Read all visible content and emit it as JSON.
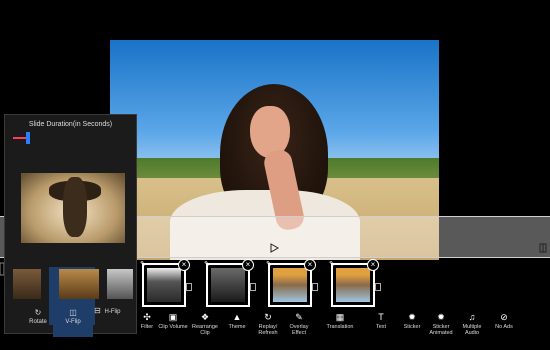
{
  "panel": {
    "title": "Slide Duration(in Seconds)",
    "actions": [
      {
        "label": "Rotate",
        "icon": "rotate-icon"
      },
      {
        "label": "V-Flip",
        "icon": "v-flip-icon"
      },
      {
        "label": "H-Flip",
        "icon": "h-flip-icon"
      }
    ],
    "slider_value_fraction": 0.1,
    "colors": {
      "accent": "#2b7fff",
      "track": "#ff3a5a",
      "selected": "#1e3d68"
    }
  },
  "toolbar": {
    "items": [
      {
        "label": "Filter",
        "icon": "filter-icon"
      },
      {
        "label": "Clip Volume",
        "icon": "volume-icon"
      },
      {
        "label": "Rearrange Clip",
        "icon": "rearrange-icon"
      },
      {
        "label": "Theme",
        "icon": "theme-icon"
      },
      {
        "label": "Replay/ Refresh",
        "icon": "refresh-icon"
      },
      {
        "label": "Overlay Effect",
        "icon": "overlay-icon"
      },
      {
        "label": "Translation",
        "icon": "translation-icon"
      },
      {
        "label": "Text",
        "icon": "text-icon"
      },
      {
        "label": "Sticker",
        "icon": "sticker-icon"
      },
      {
        "label": "Sticker Animated",
        "icon": "sticker-animated-icon"
      },
      {
        "label": "Multiple Audio",
        "icon": "audio-icon"
      },
      {
        "label": "No Ads",
        "icon": "no-ads-icon"
      }
    ]
  }
}
